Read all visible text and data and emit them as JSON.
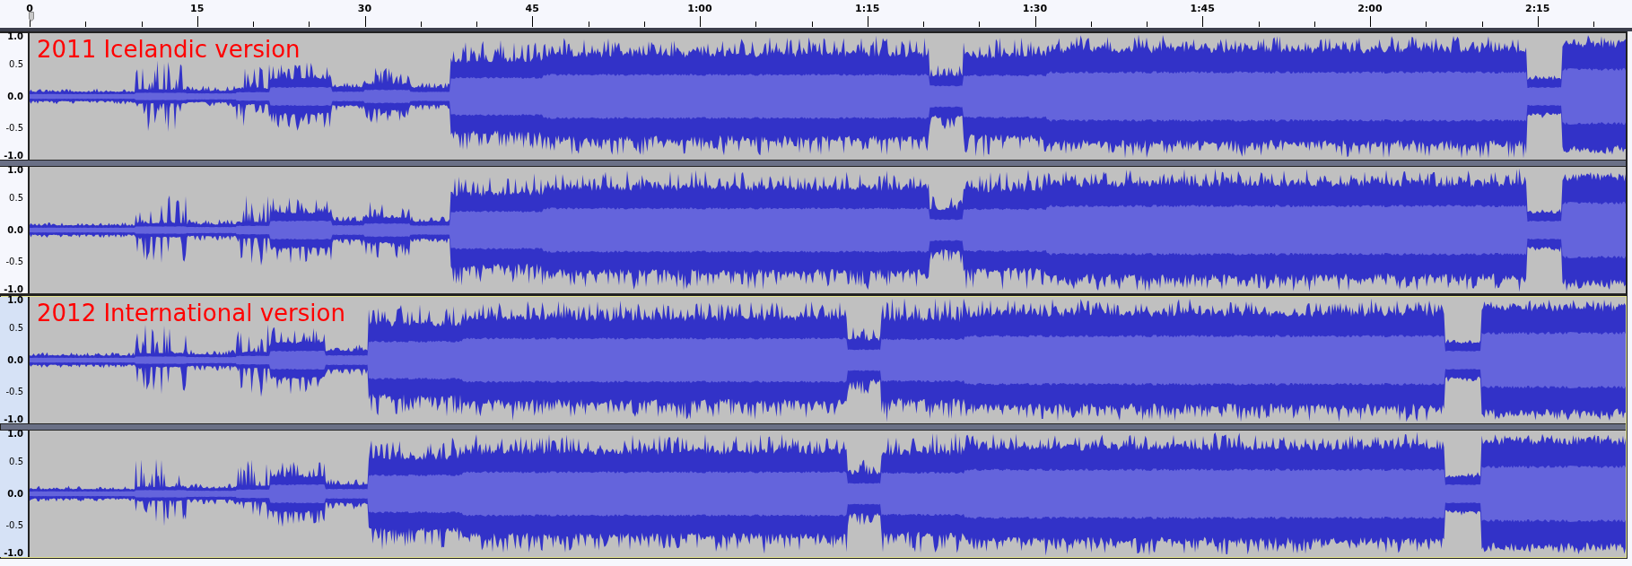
{
  "ruler": {
    "labels": [
      "0",
      "15",
      "30",
      "45",
      "1:00",
      "1:15",
      "1:30",
      "1:45",
      "2:00",
      "2:15"
    ]
  },
  "tracks": [
    {
      "title": "2011 Icelandic version",
      "selected": false,
      "channels": [
        {
          "scale": [
            "1.0",
            "0.5",
            "0.0",
            "-0.5",
            "-1.0"
          ]
        },
        {
          "scale": [
            "1.0",
            "0.5",
            "0.0",
            "-0.5",
            "-1.0"
          ]
        }
      ]
    },
    {
      "title": "2012 International version",
      "selected": true,
      "channels": [
        {
          "scale": [
            "1.0",
            "0.5",
            "0.0",
            "-0.5",
            "-1.0"
          ]
        },
        {
          "scale": [
            "1.0",
            "0.5",
            "0.0",
            "-0.5",
            "-1.0"
          ]
        }
      ]
    }
  ]
}
